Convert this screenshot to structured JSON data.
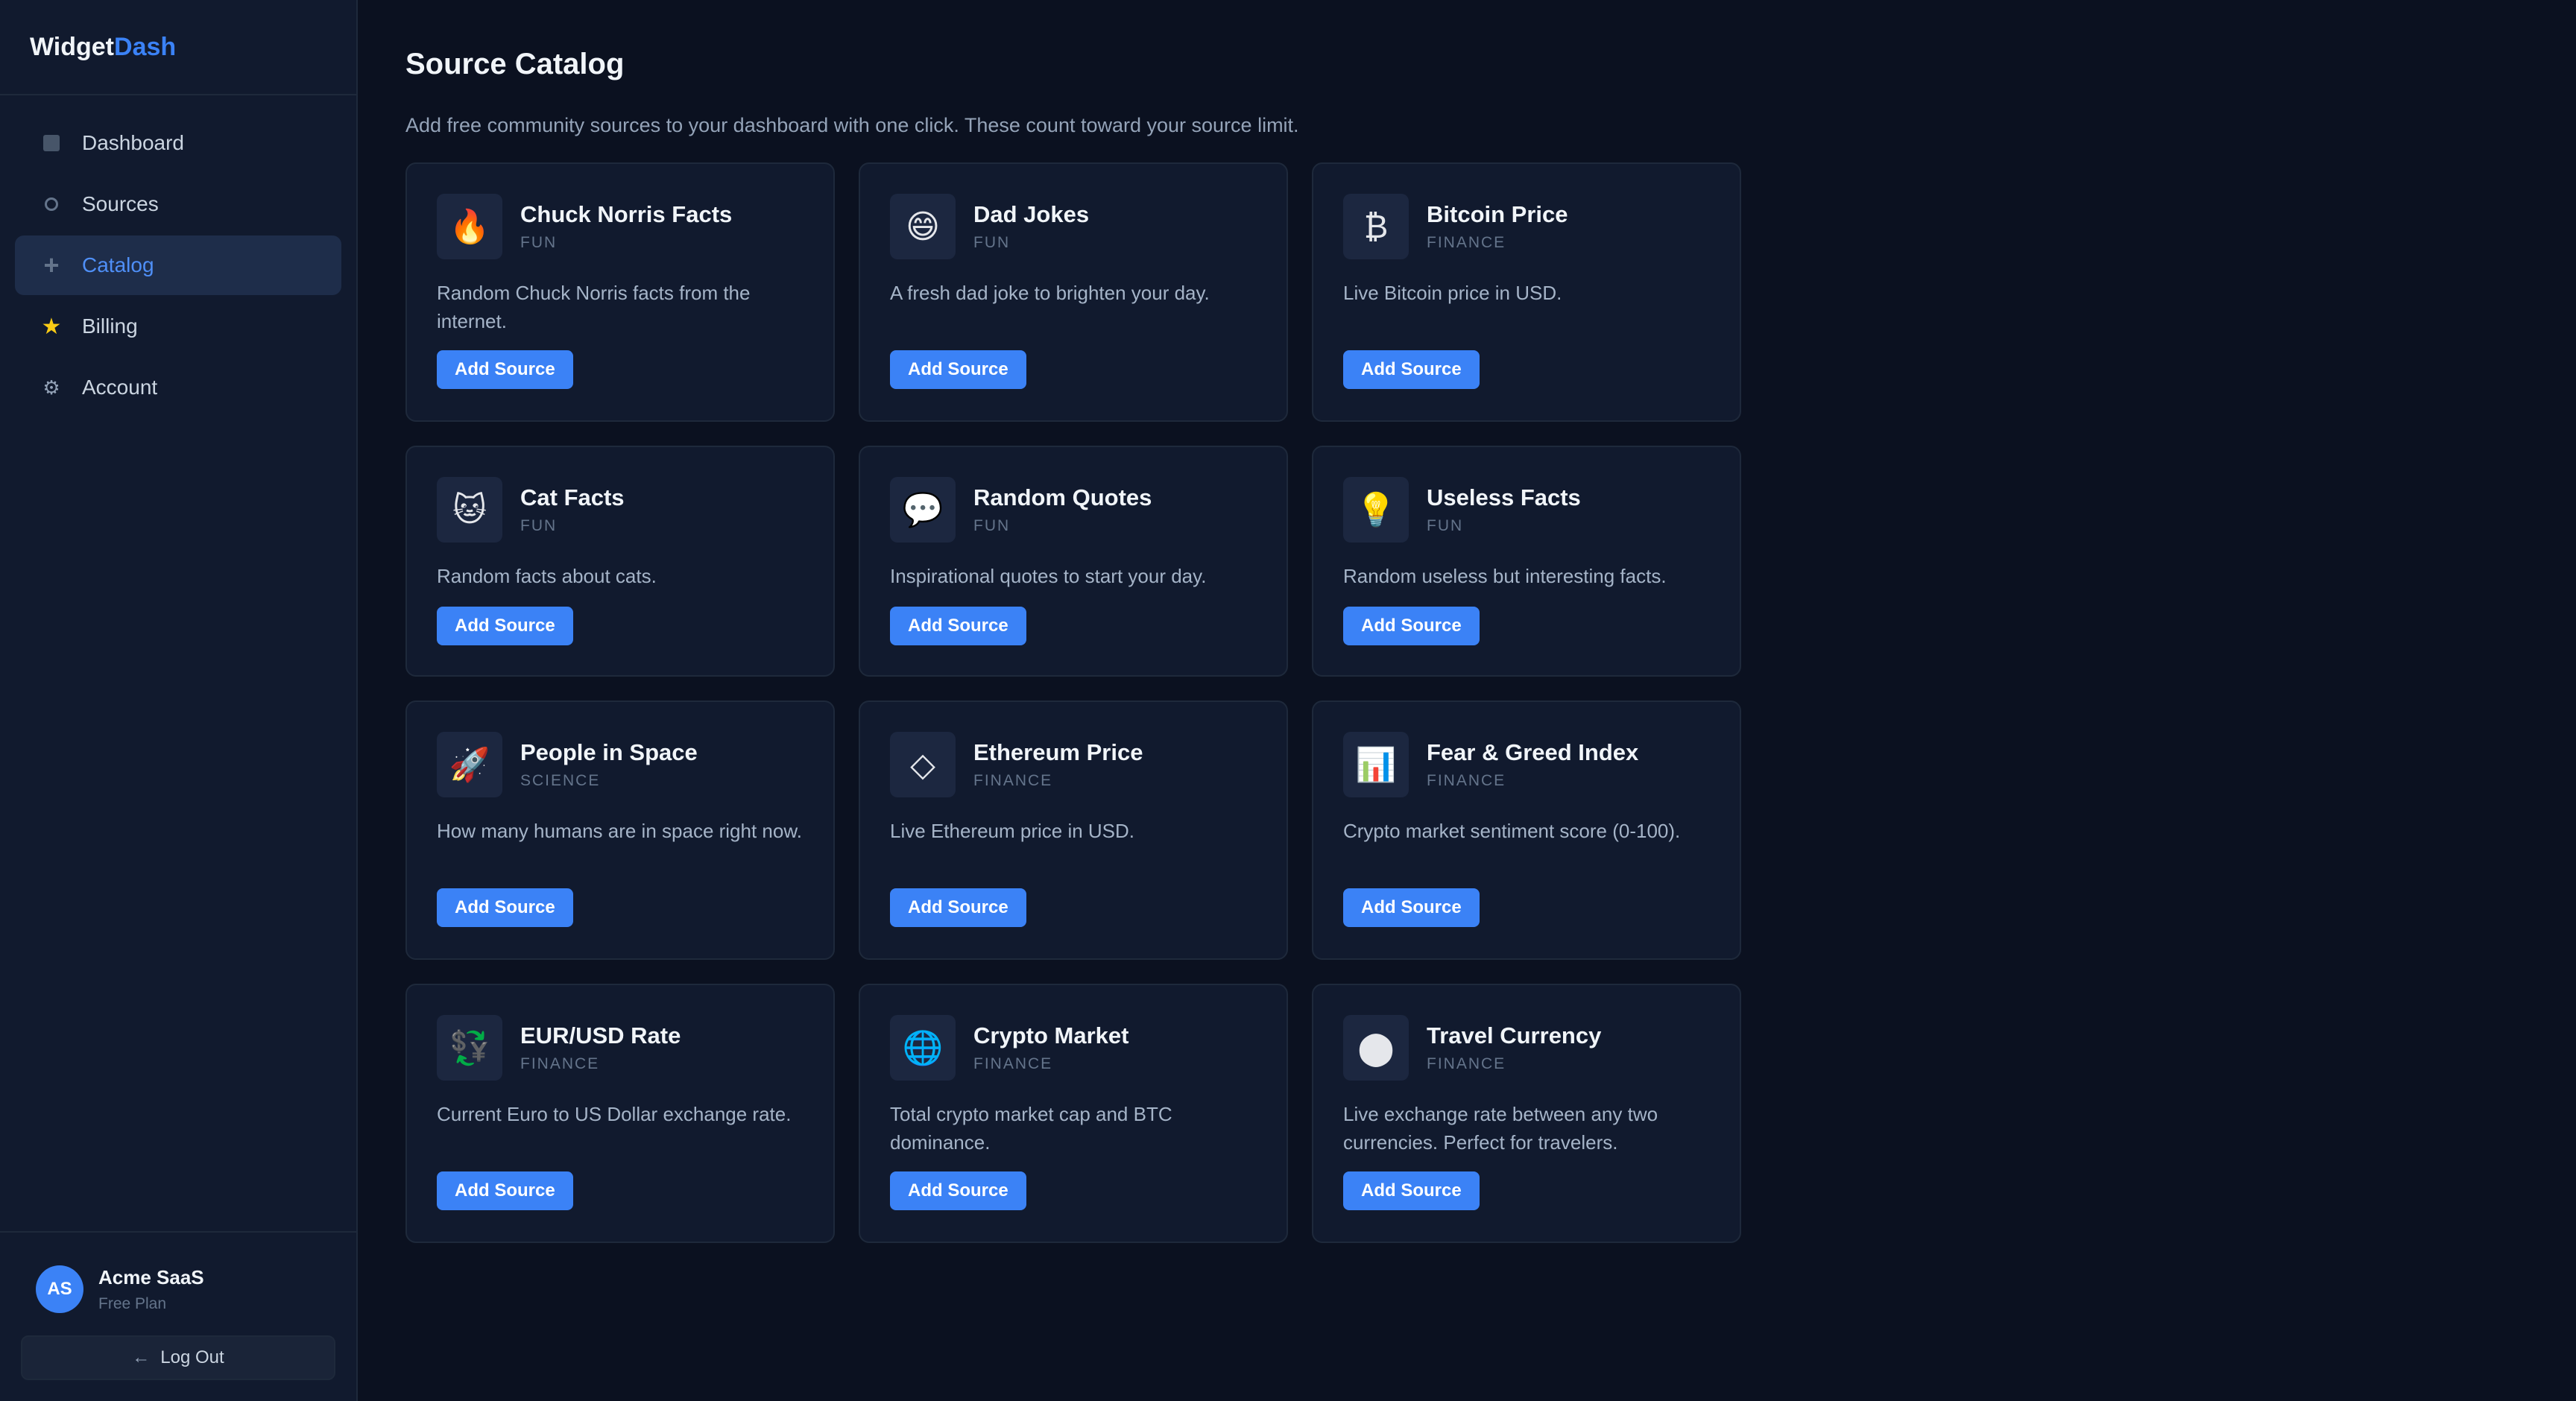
{
  "brand": {
    "part1": "Widget",
    "part2": "Dash"
  },
  "nav": [
    {
      "label": "Dashboard",
      "icon": "dashboard-icon"
    },
    {
      "label": "Sources",
      "icon": "sources-icon"
    },
    {
      "label": "Catalog",
      "icon": "plus-icon",
      "active": true
    },
    {
      "label": "Billing",
      "icon": "star-icon"
    },
    {
      "label": "Account",
      "icon": "gear-icon"
    }
  ],
  "user": {
    "initials": "AS",
    "name": "Acme SaaS",
    "plan": "Free Plan"
  },
  "logout": {
    "arrow": "←",
    "label": "Log Out"
  },
  "page": {
    "title": "Source Catalog",
    "description": "Add free community sources to your dashboard with one click. These count toward your source limit."
  },
  "cards": [
    {
      "icon": "🔥",
      "icon_name": "fire-icon",
      "title": "Chuck Norris Facts",
      "category": "FUN",
      "description": "Random Chuck Norris facts from the internet.",
      "button": "Add Source"
    },
    {
      "icon": "😄",
      "icon_name": "smile-icon",
      "title": "Dad Jokes",
      "category": "FUN",
      "description": "A fresh dad joke to brighten your day.",
      "button": "Add Source"
    },
    {
      "icon": "₿",
      "icon_name": "bitcoin-icon",
      "title": "Bitcoin Price",
      "category": "FINANCE",
      "description": "Live Bitcoin price in USD.",
      "button": "Add Source"
    },
    {
      "icon": "🐱",
      "icon_name": "cat-icon",
      "title": "Cat Facts",
      "category": "FUN",
      "description": "Random facts about cats.",
      "button": "Add Source"
    },
    {
      "icon": "💬",
      "icon_name": "speech-bubble-icon",
      "title": "Random Quotes",
      "category": "FUN",
      "description": "Inspirational quotes to start your day.",
      "button": "Add Source"
    },
    {
      "icon": "💡",
      "icon_name": "lightbulb-icon",
      "title": "Useless Facts",
      "category": "FUN",
      "description": "Random useless but interesting facts.",
      "button": "Add Source"
    },
    {
      "icon": "🚀",
      "icon_name": "rocket-icon",
      "title": "People in Space",
      "category": "SCIENCE",
      "description": "How many humans are in space right now.",
      "button": "Add Source"
    },
    {
      "icon": "◇",
      "icon_name": "ethereum-icon",
      "title": "Ethereum Price",
      "category": "FINANCE",
      "description": "Live Ethereum price in USD.",
      "button": "Add Source"
    },
    {
      "icon": "📊",
      "icon_name": "bar-chart-icon",
      "title": "Fear & Greed Index",
      "category": "FINANCE",
      "description": "Crypto market sentiment score (0-100).",
      "button": "Add Source"
    },
    {
      "icon": "💱",
      "icon_name": "currency-exchange-icon",
      "title": "EUR/USD Rate",
      "category": "FINANCE",
      "description": "Current Euro to US Dollar exchange rate.",
      "button": "Add Source"
    },
    {
      "icon": "🌐",
      "icon_name": "globe-icon",
      "title": "Crypto Market",
      "category": "FINANCE",
      "description": "Total crypto market cap and BTC dominance.",
      "button": "Add Source"
    },
    {
      "icon": "⬤",
      "icon_name": "circle-icon",
      "title": "Travel Currency",
      "category": "FINANCE",
      "description": "Live exchange rate between any two currencies. Perfect for travelers.",
      "button": "Add Source"
    }
  ]
}
